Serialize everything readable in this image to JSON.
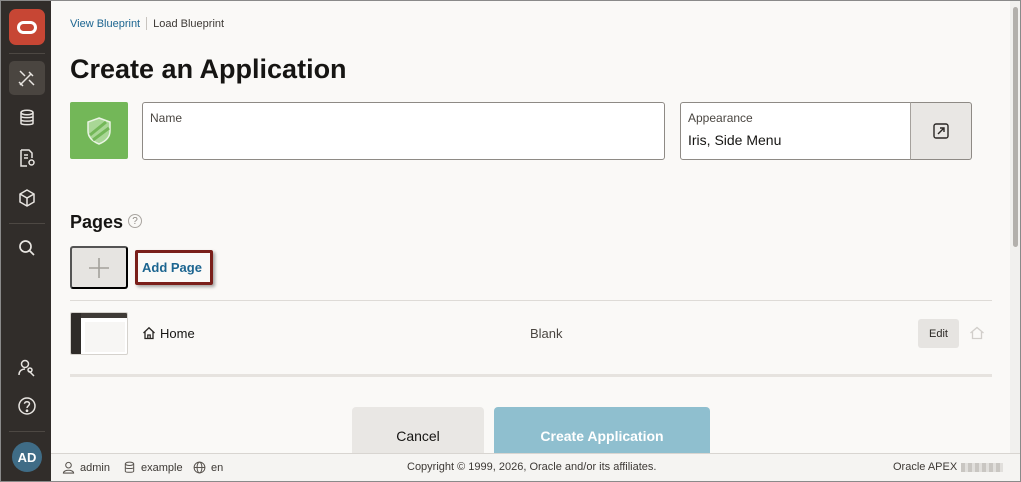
{
  "breadcrumb": {
    "view_blueprint": "View Blueprint",
    "load_blueprint": "Load Blueprint"
  },
  "page_title": "Create an Application",
  "name_field": {
    "label": "Name",
    "value": ""
  },
  "appearance_field": {
    "label": "Appearance",
    "value": "Iris, Side Menu"
  },
  "pages_section": {
    "title": "Pages",
    "help": "?",
    "add_page_label": "Add Page",
    "rows": [
      {
        "name": "Home",
        "type": "Blank",
        "edit_label": "Edit"
      }
    ]
  },
  "actions": {
    "cancel_label": "Cancel",
    "create_label": "Create Application"
  },
  "nav": {
    "avatar_initials": "AD"
  },
  "footer": {
    "user": "admin",
    "workspace": "example",
    "language": "en",
    "copyright": "Copyright © 1999, 2026, Oracle and/or its affiliates.",
    "product": "Oracle APEX"
  },
  "colors": {
    "brand_red": "#c74634",
    "app_icon_green": "#73b758",
    "link_blue": "#1c6590",
    "primary_button": "#8fbfcf",
    "highlight_box": "#7a1f1a",
    "nav_rail": "#312d2a"
  },
  "icons": {
    "logo": "oracle-logo-icon",
    "app_builder": "app-builder-icon",
    "sql_workshop": "sql-workshop-icon",
    "team_development": "team-development-icon",
    "gallery": "gallery-icon",
    "search": "search-icon",
    "administration": "administration-icon",
    "help": "help-icon",
    "app_icon": "shield-icon",
    "appearance_settings": "open-settings-icon",
    "add": "plus-icon",
    "home": "home-icon"
  }
}
